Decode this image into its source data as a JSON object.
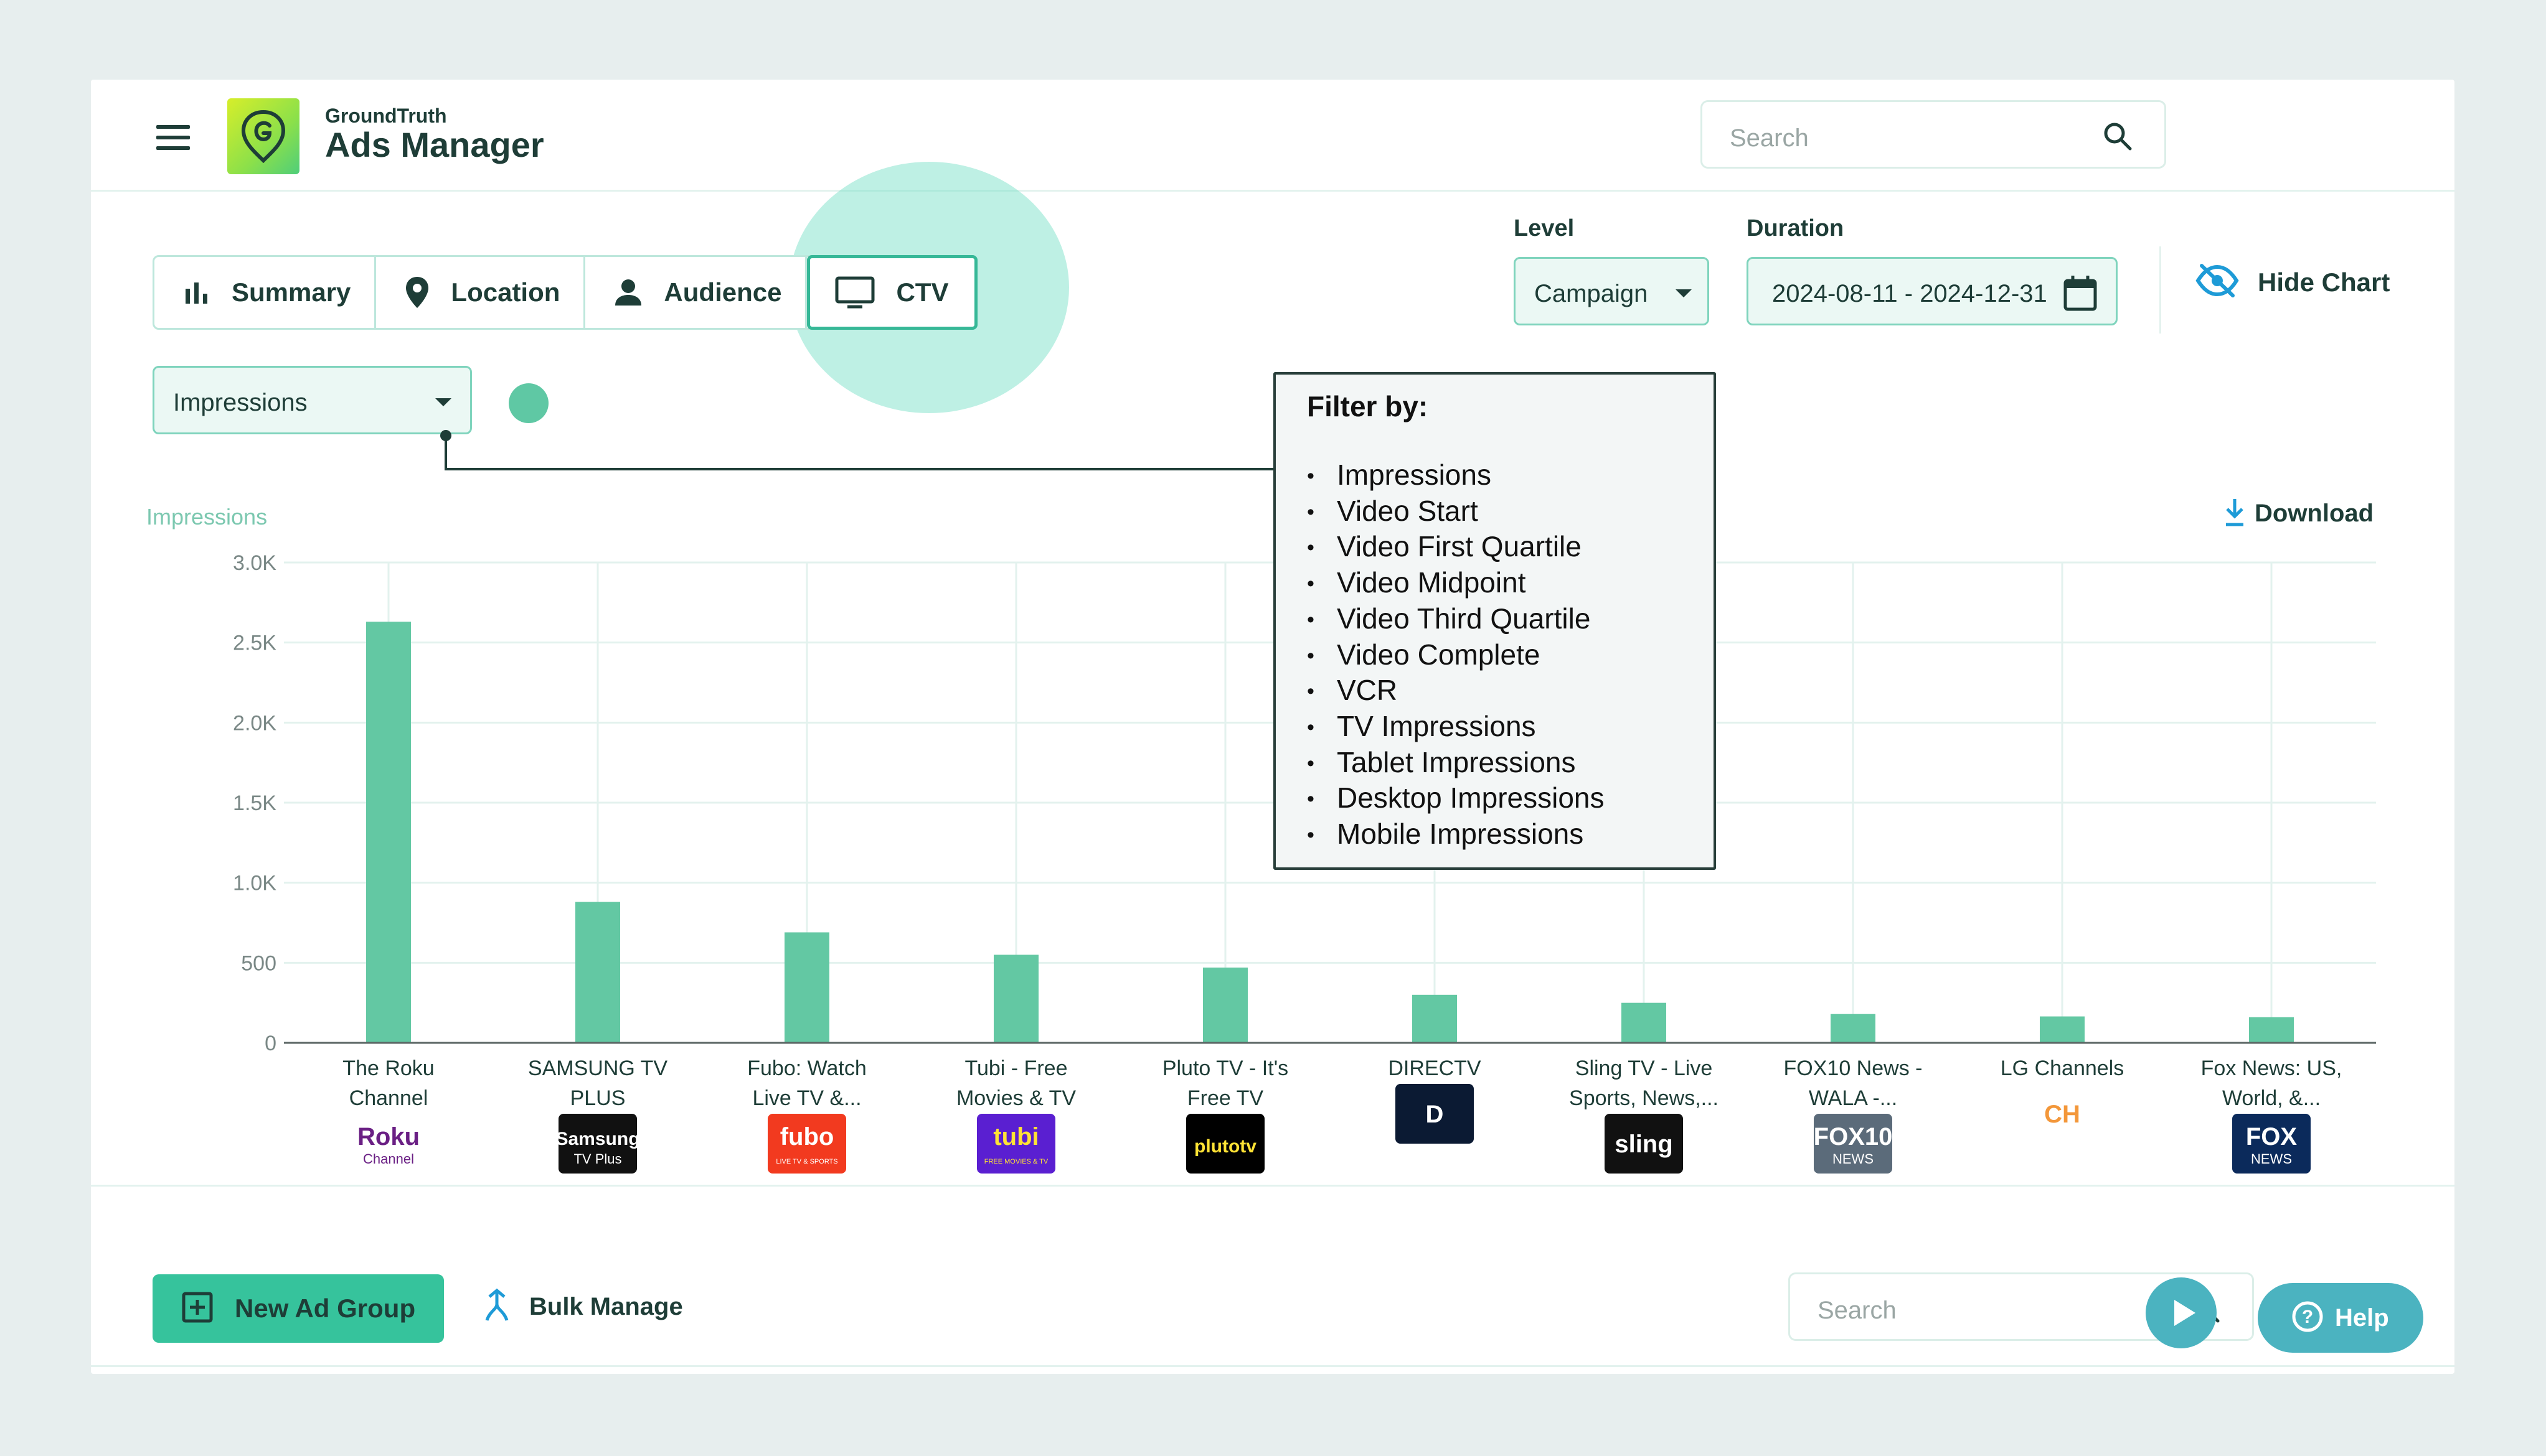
{
  "header": {
    "brand_small": "GroundTruth",
    "brand_large": "Ads Manager",
    "search_placeholder": "Search"
  },
  "tabs": [
    {
      "label": "Summary",
      "icon": "bar-chart-icon"
    },
    {
      "label": "Location",
      "icon": "location-pin-icon"
    },
    {
      "label": "Audience",
      "icon": "person-icon"
    },
    {
      "label": "CTV",
      "icon": "tv-icon",
      "active": true
    }
  ],
  "controls": {
    "level_label": "Level",
    "level_value": "Campaign",
    "duration_label": "Duration",
    "duration_value": "2024-08-11 - 2024-12-31",
    "hide_chart_label": "Hide Chart",
    "metric_value": "Impressions",
    "download_label": "Download"
  },
  "popup": {
    "title": "Filter by:",
    "items": [
      "Impressions",
      "Video Start",
      "Video First Quartile",
      "Video Midpoint",
      "Video Third Quartile",
      "Video Complete",
      "VCR",
      "TV Impressions",
      "Tablet Impressions",
      "Desktop Impressions",
      "Mobile Impressions"
    ]
  },
  "chart_data": {
    "type": "bar",
    "ylabel": "Impressions",
    "ylim": [
      0,
      3000
    ],
    "yticks": [
      "0",
      "500",
      "1.0K",
      "1.5K",
      "2.0K",
      "2.5K",
      "3.0K"
    ],
    "grid": true,
    "categories": [
      [
        "The Roku",
        "Channel"
      ],
      [
        "SAMSUNG TV",
        "PLUS"
      ],
      [
        "Fubo: Watch",
        "Live TV &..."
      ],
      [
        "Tubi - Free",
        "Movies & TV"
      ],
      [
        "Pluto TV - It's",
        "Free TV"
      ],
      [
        "DIRECTV",
        ""
      ],
      [
        "Sling TV - Live",
        "Sports, News,..."
      ],
      [
        "FOX10 News -",
        "WALA -..."
      ],
      [
        "LG Channels",
        ""
      ],
      [
        "Fox News: US,",
        "World, &..."
      ]
    ],
    "values": [
      2630,
      880,
      690,
      550,
      470,
      300,
      250,
      180,
      165,
      160
    ],
    "bar_color": "#63c8a3",
    "logos": [
      {
        "icon": "roku-channel-logo",
        "text": [
          "Roku",
          "Channel"
        ],
        "bg": "#ffffff",
        "fg": "#6a1f84"
      },
      {
        "icon": "samsung-tv-plus-logo",
        "text": [
          "Samsung",
          "TV Plus"
        ],
        "bg": "#111111",
        "fg": "#ffffff"
      },
      {
        "icon": "fubo-logo",
        "text": [
          "fubo",
          "LIVE TV & SPORTS"
        ],
        "bg": "#f23a1f",
        "fg": "#ffffff"
      },
      {
        "icon": "tubi-logo",
        "text": [
          "tubi",
          "FREE MOVIES & TV"
        ],
        "bg": "#5a1fd1",
        "fg": "#ffe335"
      },
      {
        "icon": "pluto-tv-logo",
        "text": [
          "plutotv",
          ""
        ],
        "bg": "#000000",
        "fg": "#ffe335"
      },
      {
        "icon": "directv-logo",
        "text": [
          "D",
          ""
        ],
        "bg": "#0b1a33",
        "fg": "#ffffff"
      },
      {
        "icon": "sling-logo",
        "text": [
          "sling",
          ""
        ],
        "bg": "#111111",
        "fg": "#ffffff"
      },
      {
        "icon": "fox10-news-logo",
        "text": [
          "FOX10",
          "NEWS"
        ],
        "bg": "#5b6b7a",
        "fg": "#ffffff"
      },
      {
        "icon": "lg-channels-logo",
        "text": [
          "CH",
          ""
        ],
        "bg": "#ffffff",
        "fg": "#f3973a"
      },
      {
        "icon": "fox-news-logo",
        "text": [
          "FOX",
          "NEWS"
        ],
        "bg": "#0b2a5b",
        "fg": "#ffffff"
      }
    ]
  },
  "bottom": {
    "new_ad_group_label": "New Ad Group",
    "bulk_manage_label": "Bulk Manage",
    "search_placeholder": "Search",
    "help_label": "Help"
  },
  "colors": {
    "accent": "#36c39c",
    "border": "#bde7dc",
    "text": "#1e3d37",
    "help": "#4bb3c0"
  }
}
